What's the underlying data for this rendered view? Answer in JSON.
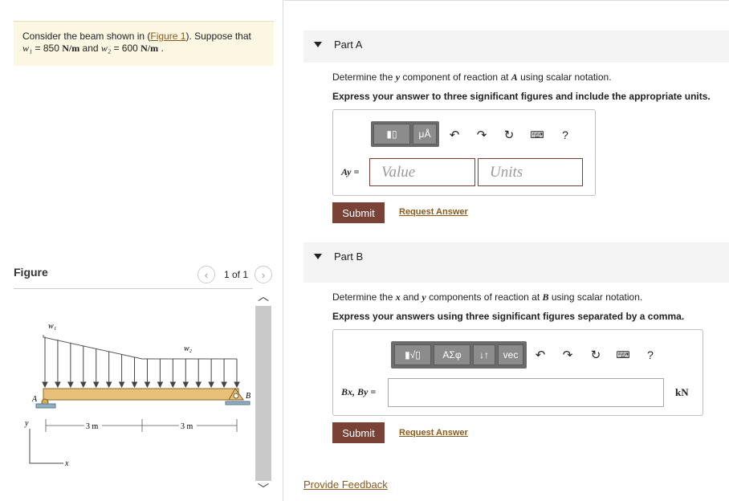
{
  "problem": {
    "text_prefix": "Consider the beam shown in (",
    "figure_link": "Figure 1",
    "text_suffix": "). Suppose that",
    "w1_sym": "w₁",
    "w1_val": " = 850 ",
    "w1_unit": "N/m",
    "and": " and ",
    "w2_sym": "w₂",
    "w2_val": " = 600 ",
    "w2_unit": "N/m",
    "end": " ."
  },
  "figure": {
    "title": "Figure",
    "pager": "1 of 1",
    "prev": "‹",
    "next": "›",
    "labels": {
      "w1": "w₁",
      "w2": "w₂",
      "A": "A",
      "B": "B",
      "dim1": "3 m",
      "dim2": "3 m",
      "y": "y",
      "x": "x"
    }
  },
  "partA": {
    "label": "Part A",
    "q_prefix": "Determine the ",
    "q_var": "y",
    "q_mid": " component of reaction at ",
    "q_point": "A",
    "q_suffix": " using scalar notation.",
    "instruction": "Express your answer to three significant figures and include the appropriate units.",
    "toolbar": {
      "templates": "▮▯",
      "units": "μÅ",
      "help": "?"
    },
    "answer_label": "Ay =",
    "value_placeholder": "Value",
    "units_placeholder": "Units",
    "submit": "Submit",
    "request": "Request Answer"
  },
  "partB": {
    "label": "Part B",
    "q_prefix": "Determine the ",
    "q_var1": "x",
    "q_mid1": " and ",
    "q_var2": "y",
    "q_mid2": " components of reaction at ",
    "q_point": "B",
    "q_suffix": " using scalar notation.",
    "instruction": "Express your answers using three significant figures separated by a comma.",
    "toolbar": {
      "templates": "▮√▯",
      "greek": "ΑΣφ",
      "arrows": "↓↑",
      "vec": "vec",
      "help": "?"
    },
    "answer_label": "Bx, By =",
    "unit": "kN",
    "submit": "Submit",
    "request": "Request Answer"
  },
  "feedback": "Provide Feedback"
}
